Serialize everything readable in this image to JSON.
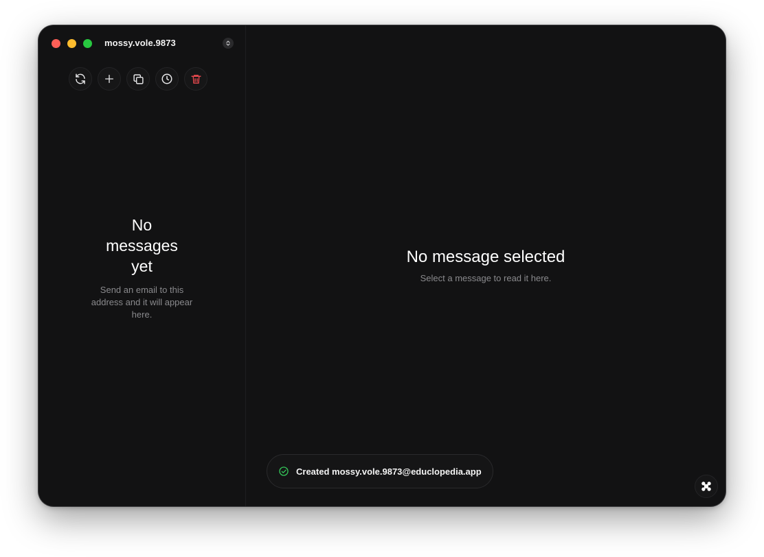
{
  "window": {
    "account_name": "mossy.vole.9873"
  },
  "toolbar": {
    "buttons": [
      {
        "icon": "refresh-icon"
      },
      {
        "icon": "plus-icon"
      },
      {
        "icon": "copy-icon"
      },
      {
        "icon": "clock-icon"
      },
      {
        "icon": "trash-icon",
        "color": "#e5484d"
      }
    ]
  },
  "message_list": {
    "empty_title": "No messages yet",
    "empty_subtitle": "Send an email to this address and it will appear here."
  },
  "reader": {
    "empty_title": "No message selected",
    "empty_subtitle": "Select a message to read it here."
  },
  "toast": {
    "icon": "check-circle-icon",
    "text": "Created mossy.vole.9873@educlopedia.app",
    "icon_color": "#34c759"
  },
  "corner_button": {
    "icon": "command-icon"
  },
  "colors": {
    "background": "#121213",
    "close": "#fe5f57",
    "minimize": "#febc2e",
    "maximize": "#28c840",
    "danger": "#e5484d",
    "success": "#34c759"
  }
}
